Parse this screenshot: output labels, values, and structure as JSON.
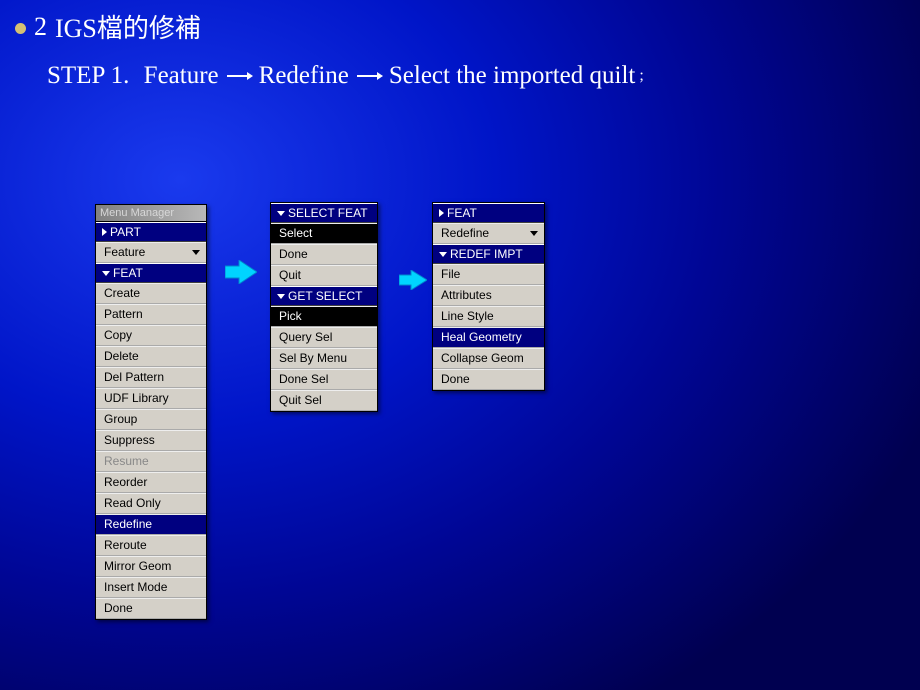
{
  "title_num": "2",
  "title_text": "IGS檔的修補",
  "step_label": "STEP 1.",
  "step_parts": [
    "Feature",
    "Redefine",
    "Select the imported quilt"
  ],
  "step_suffix": ";",
  "panel1": {
    "titlebar": "Menu Manager",
    "headers": {
      "part": "PART",
      "feat": "FEAT"
    },
    "feature_dropdown": "Feature",
    "items": [
      "Create",
      "Pattern",
      "Copy",
      "Delete",
      "Del Pattern",
      "UDF Library",
      "Group",
      "Suppress",
      "Resume",
      "Reorder",
      "Read Only",
      "Redefine",
      "Reroute",
      "Mirror Geom",
      "Insert Mode",
      "Done"
    ]
  },
  "panel2": {
    "headers": {
      "select_feat": "SELECT FEAT",
      "get_select": "GET SELECT"
    },
    "group1": [
      "Select",
      "Done",
      "Quit"
    ],
    "group2": [
      "Pick",
      "Query Sel",
      "Sel By Menu",
      "Done Sel",
      "Quit Sel"
    ]
  },
  "panel3": {
    "headers": {
      "feat": "FEAT",
      "redef_impt": "REDEF IMPT"
    },
    "redefine_dropdown": "Redefine",
    "items": [
      "File",
      "Attributes",
      "Line Style",
      "Heal Geometry",
      "Collapse Geom",
      "Done"
    ]
  }
}
